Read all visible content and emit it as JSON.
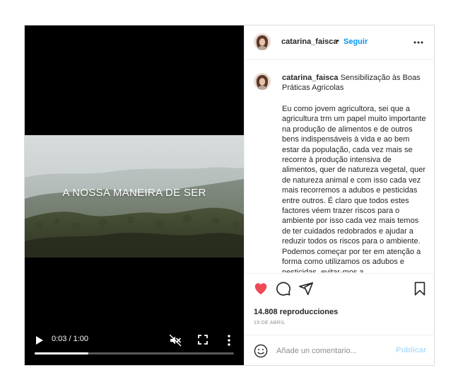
{
  "colors": {
    "accent": "#0095f6",
    "like_red": "#ed4956",
    "post_disabled": "#b2dffc",
    "muted_text": "#8e8e8e",
    "border": "#dbdbdb"
  },
  "video": {
    "overlay_title": "A NOSSA MANEIRA DE SER",
    "time": "0:03 / 1:00",
    "progress": 0.27,
    "icons": [
      "play-icon",
      "muted-icon",
      "fullscreen-icon",
      "more-vertical-icon"
    ]
  },
  "header": {
    "username": "catarina_faisca",
    "separator": "•",
    "follow_label": "Seguir",
    "more_icon": "more-horizontal-icon"
  },
  "caption": {
    "username": "catarina_faisca",
    "title": "Sensibilização às Boas Práticas Agricolas",
    "body": "Eu como jovem agricultora, sei que a agricultura trm um papel muito importante na produção de alimentos e de outros bens indispensáveis à vida e ao bem estar da população, cada vez mais se recorre à produção intensiva de alimentos, quer de natureza vegetal, quer de natureza animal e com isso cada vez mais recorremos a adubos e pesticidas entre outros. É claro que todos estes factores véem trazer riscos para o ambiente por isso cada vez mais temos de ter cuidados redobrados e ajudar a reduzir todos os riscos para o ambiente. Podemos começar por ter em atenção a forma como utilizamos os adubos e pesticidas, evitar-mos a"
  },
  "actions": {
    "icons": [
      "heart-icon",
      "comment-icon",
      "share-icon",
      "bookmark-icon"
    ],
    "liked": true,
    "views": "14.808 reproducciones",
    "date": "19 DE ABRIL"
  },
  "add_comment": {
    "placeholder": "Añade un comentario...",
    "post_label": "Publicar",
    "emoji_icon": "smile-icon"
  }
}
